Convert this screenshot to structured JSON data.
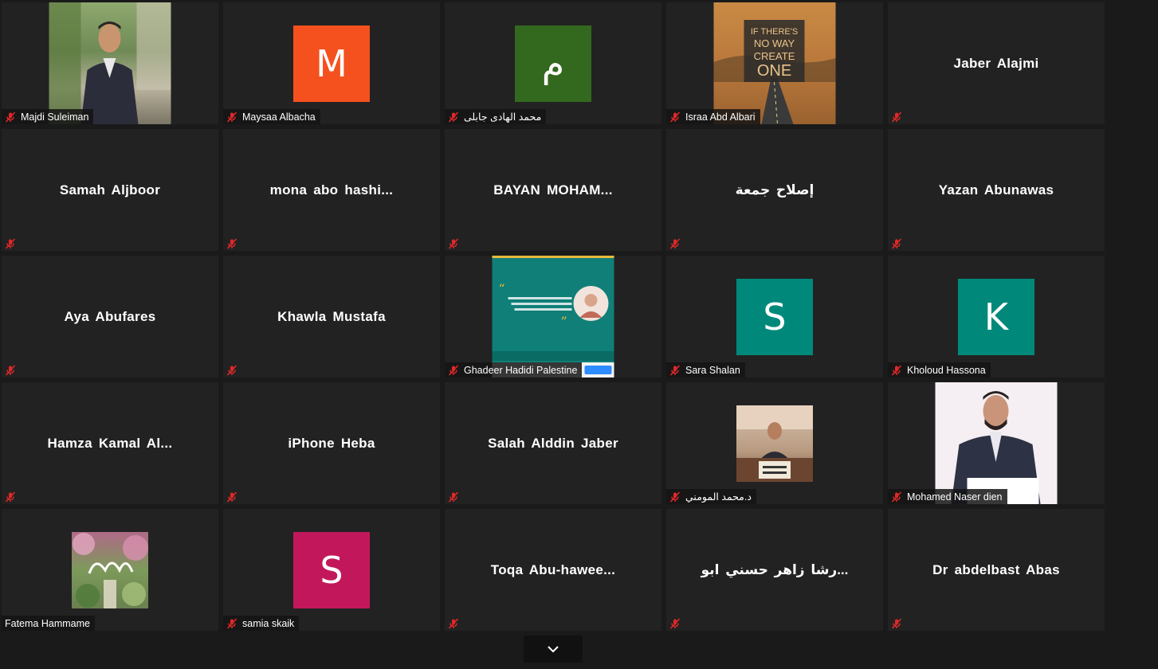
{
  "participants": [
    {
      "name": "Majdi Suleiman",
      "tile": "photo",
      "photo": "man-suit",
      "muted": true
    },
    {
      "name": "Maysaa Albacha",
      "tile": "avatar",
      "initial": "M",
      "color": "#f4511e",
      "muted": true
    },
    {
      "name": "محمد الهادى جابلى",
      "tile": "avatar",
      "initial": "م",
      "color": "#33691e",
      "muted": true
    },
    {
      "name": "Israa Abd Albari",
      "tile": "photo",
      "photo": "road-poster",
      "poster_text": [
        "IF THERE'S",
        "NO WAY",
        "CREATE",
        "ONE"
      ],
      "muted": true
    },
    {
      "name": "Jaber Alajmi",
      "tile": "name",
      "muted": true
    },
    {
      "name": "Samah Aljboor",
      "tile": "name",
      "muted": true
    },
    {
      "name": "mona  abo  hashi...",
      "tile": "name",
      "muted": true
    },
    {
      "name": "BAYAN  MOHAM...",
      "tile": "name",
      "muted": true
    },
    {
      "name": "إصلاح جمعة",
      "tile": "name",
      "muted": true
    },
    {
      "name": "Yazan Abunawas",
      "tile": "name",
      "muted": true
    },
    {
      "name": "Aya Abufares",
      "tile": "name",
      "muted": true
    },
    {
      "name": "Khawla Mustafa",
      "tile": "name",
      "muted": true
    },
    {
      "name": "Ghadeer Hadidi Palestine",
      "tile": "photo",
      "photo": "teal-quote-card",
      "muted": true
    },
    {
      "name": "Sara Shalan",
      "tile": "avatar",
      "initial": "S",
      "color": "#00897b",
      "muted": true
    },
    {
      "name": "Kholoud Hassona",
      "tile": "avatar",
      "initial": "K",
      "color": "#00897b",
      "muted": true
    },
    {
      "name": "Hamza  Kamal  Al...",
      "tile": "name",
      "muted": true
    },
    {
      "name": "iPhone Heba",
      "tile": "name",
      "muted": true
    },
    {
      "name": "Salah Alddin Jaber",
      "tile": "name",
      "muted": true
    },
    {
      "name": "د.محمد المومني",
      "tile": "photo",
      "photo": "man-desk",
      "muted": true
    },
    {
      "name": "Mohamed Naser dien",
      "tile": "photo",
      "photo": "man-writing",
      "muted": true
    },
    {
      "name": "Fatema Hammame",
      "tile": "photo",
      "photo": "floral-calligraphy",
      "muted": false
    },
    {
      "name": "samia skaik",
      "tile": "avatar",
      "initial": "S",
      "color": "#c2185b",
      "muted": true
    },
    {
      "name": "Toqa  Abu-hawee...",
      "tile": "name",
      "muted": true
    },
    {
      "name": "رشا زاهر حسني ابو...",
      "tile": "name",
      "muted": true
    },
    {
      "name": "Dr abdelbast Abas",
      "tile": "name",
      "muted": true
    }
  ],
  "controls": {
    "scroll_down_icon": "chevron-down-icon"
  }
}
